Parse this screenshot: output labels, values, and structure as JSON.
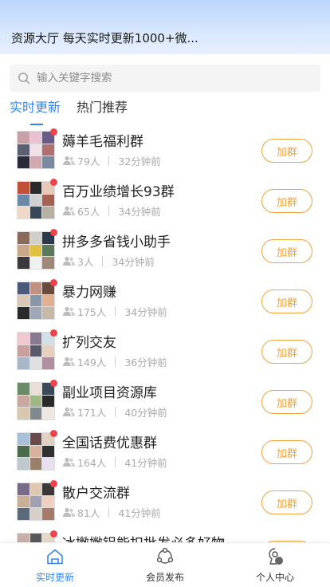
{
  "header": {
    "title": "资源大厅 每天实时更新1000+微..."
  },
  "search": {
    "placeholder": "输入关键字搜索",
    "icon": "search-icon"
  },
  "tabs": [
    {
      "label": "实时更新",
      "active": true
    },
    {
      "label": "热门推荐",
      "active": false
    }
  ],
  "join_label": "加群",
  "colors": {
    "accent": "#3a86e6",
    "button": "#f0a43a",
    "badge": "#f0424a"
  },
  "groups": [
    {
      "name": "薅羊毛福利群",
      "members": "79人",
      "time": "32分钟前"
    },
    {
      "name": "百万业绩增长93群",
      "members": "65人",
      "time": "34分钟前"
    },
    {
      "name": "拼多多省钱小助手",
      "members": "3人",
      "time": "34分钟前"
    },
    {
      "name": "暴力网赚",
      "members": "175人",
      "time": "34分钟前"
    },
    {
      "name": "扩列交友",
      "members": "149人",
      "time": "36分钟前"
    },
    {
      "name": "副业项目资源库",
      "members": "171人",
      "time": "40分钟前"
    },
    {
      "name": "全国话费优惠群",
      "members": "164人",
      "time": "41分钟前"
    },
    {
      "name": "散户交流群",
      "members": "81人",
      "time": "41分钟前"
    },
    {
      "name": "冰撇撇铝能扣批发必多好物",
      "members": "",
      "time": ""
    }
  ],
  "tabbar": [
    {
      "label": "实时更新",
      "icon": "home-icon",
      "active": true
    },
    {
      "label": "会员发布",
      "icon": "share-icon",
      "active": false
    },
    {
      "label": "个人中心",
      "icon": "user-icon",
      "active": false
    }
  ]
}
